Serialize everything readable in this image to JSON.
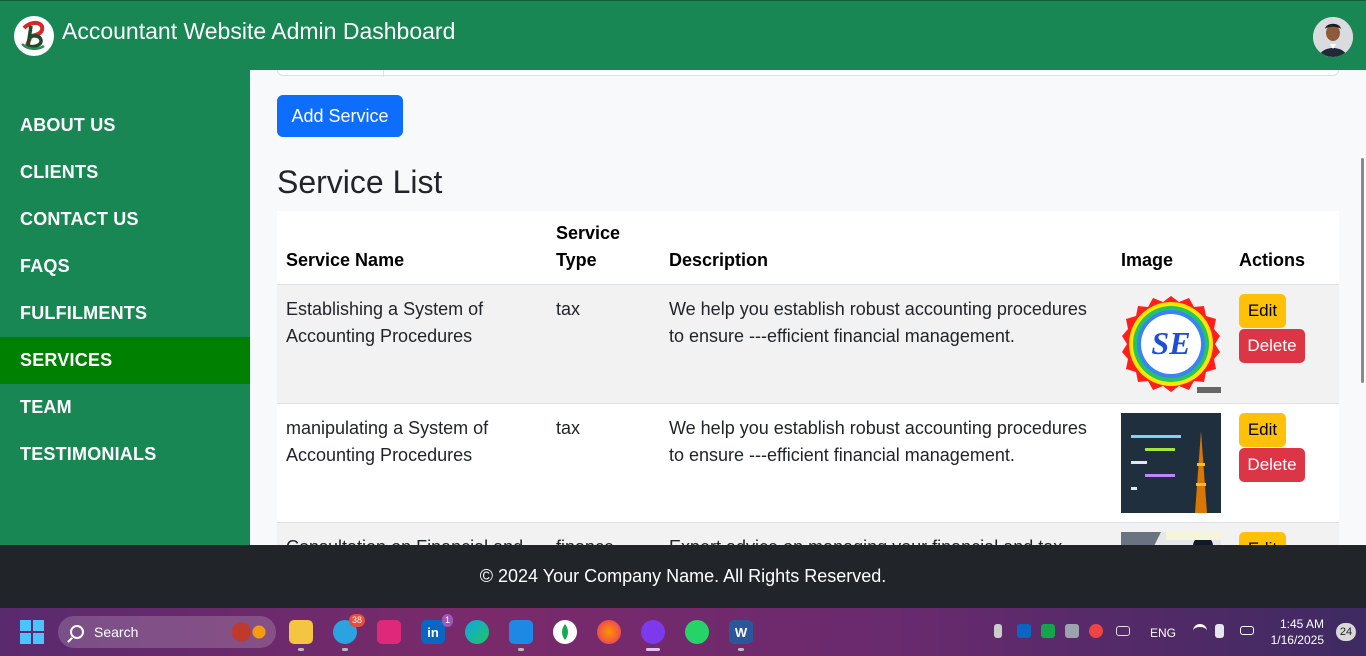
{
  "header": {
    "title": "Accountant Website Admin Dashboard"
  },
  "sidebar": {
    "items": [
      {
        "label": "ABOUT US"
      },
      {
        "label": "CLIENTS"
      },
      {
        "label": "CONTACT US"
      },
      {
        "label": "FAQS"
      },
      {
        "label": "FULFILMENTS"
      },
      {
        "label": "SERVICES",
        "active": true
      },
      {
        "label": "TEAM"
      },
      {
        "label": "TESTIMONIALS"
      }
    ]
  },
  "main": {
    "add_button_label": "Add Service",
    "section_title": "Service List",
    "table": {
      "headers": [
        "Service Name",
        "Service Type",
        "Description",
        "Image",
        "Actions"
      ],
      "rows": [
        {
          "name": "Establishing a System of Accounting Procedures",
          "type": "tax",
          "description": "We help you establish robust accounting procedures to ensure ---efficient financial management.",
          "image_icon": "se-badge-image",
          "edit_label": "Edit",
          "delete_label": "Delete"
        },
        {
          "name": "manipulating a System of Accounting Procedures",
          "type": "tax",
          "description": "We help you establish robust accounting procedures to ensure ---efficient financial management.",
          "image_icon": "code-tower-image",
          "edit_label": "Edit",
          "delete_label": "Delete"
        },
        {
          "name": "Consultation on Financial and",
          "type": "finance",
          "description": "Expert advice on managing your financial and tax",
          "image_icon": "photo-image",
          "edit_label": "Edit",
          "delete_label": ""
        }
      ]
    }
  },
  "footer": {
    "text": "© 2024 Your Company Name. All Rights Reserved."
  },
  "taskbar": {
    "search_label": "Search",
    "telegram_badge": "38",
    "linkedin_badge": "1",
    "language": "ENG",
    "time": "1:45 AM",
    "date": "1/16/2025",
    "notifications": "24"
  },
  "colors": {
    "header_bg": "#198754",
    "sidebar_active": "#008000",
    "primary_button": "#0d6efd",
    "edit_button": "#ffc107",
    "delete_button": "#dc3545",
    "footer_bg": "#212529"
  }
}
